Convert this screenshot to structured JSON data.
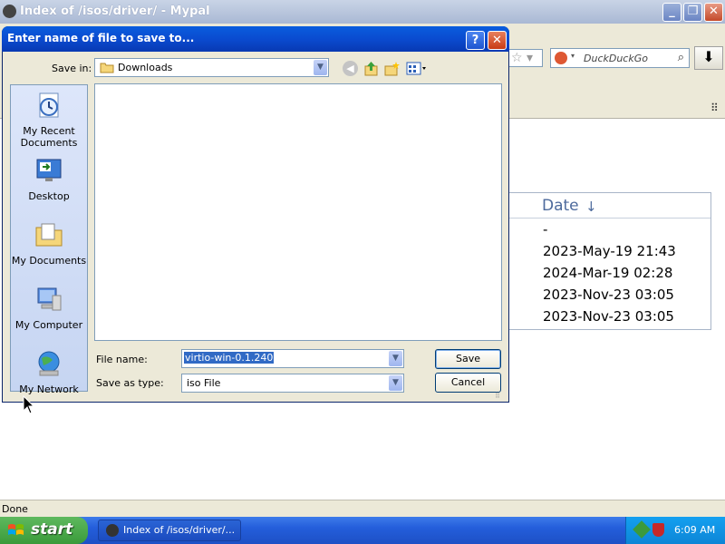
{
  "browser": {
    "title": "Index of /isos/driver/ - Mypal",
    "search_placeholder": "DuckDuckGo",
    "status": "Done"
  },
  "listing": {
    "date_header": "Date",
    "dates": [
      "-",
      "2023-May-19 21:43",
      "2024-Mar-19 02:28",
      "2023-Nov-23 03:05",
      "2023-Nov-23 03:05"
    ]
  },
  "dialog": {
    "title": "Enter name of file to save to...",
    "save_in_label": "Save in:",
    "save_in_value": "Downloads",
    "places": [
      {
        "label": "My Recent\nDocuments",
        "icon": "recent-documents-icon"
      },
      {
        "label": "Desktop",
        "icon": "desktop-icon"
      },
      {
        "label": "My Documents",
        "icon": "my-documents-icon"
      },
      {
        "label": "My Computer",
        "icon": "my-computer-icon"
      },
      {
        "label": "My Network",
        "icon": "my-network-icon"
      }
    ],
    "file_name_label": "File name:",
    "file_name_value": "virtio-win-0.1.240",
    "save_as_type_label": "Save as type:",
    "save_as_type_value": "iso File",
    "save_button": "Save",
    "cancel_button": "Cancel"
  },
  "taskbar": {
    "start_label": "start",
    "task_label": "Index of /isos/driver/...",
    "clock": "6:09 AM"
  }
}
